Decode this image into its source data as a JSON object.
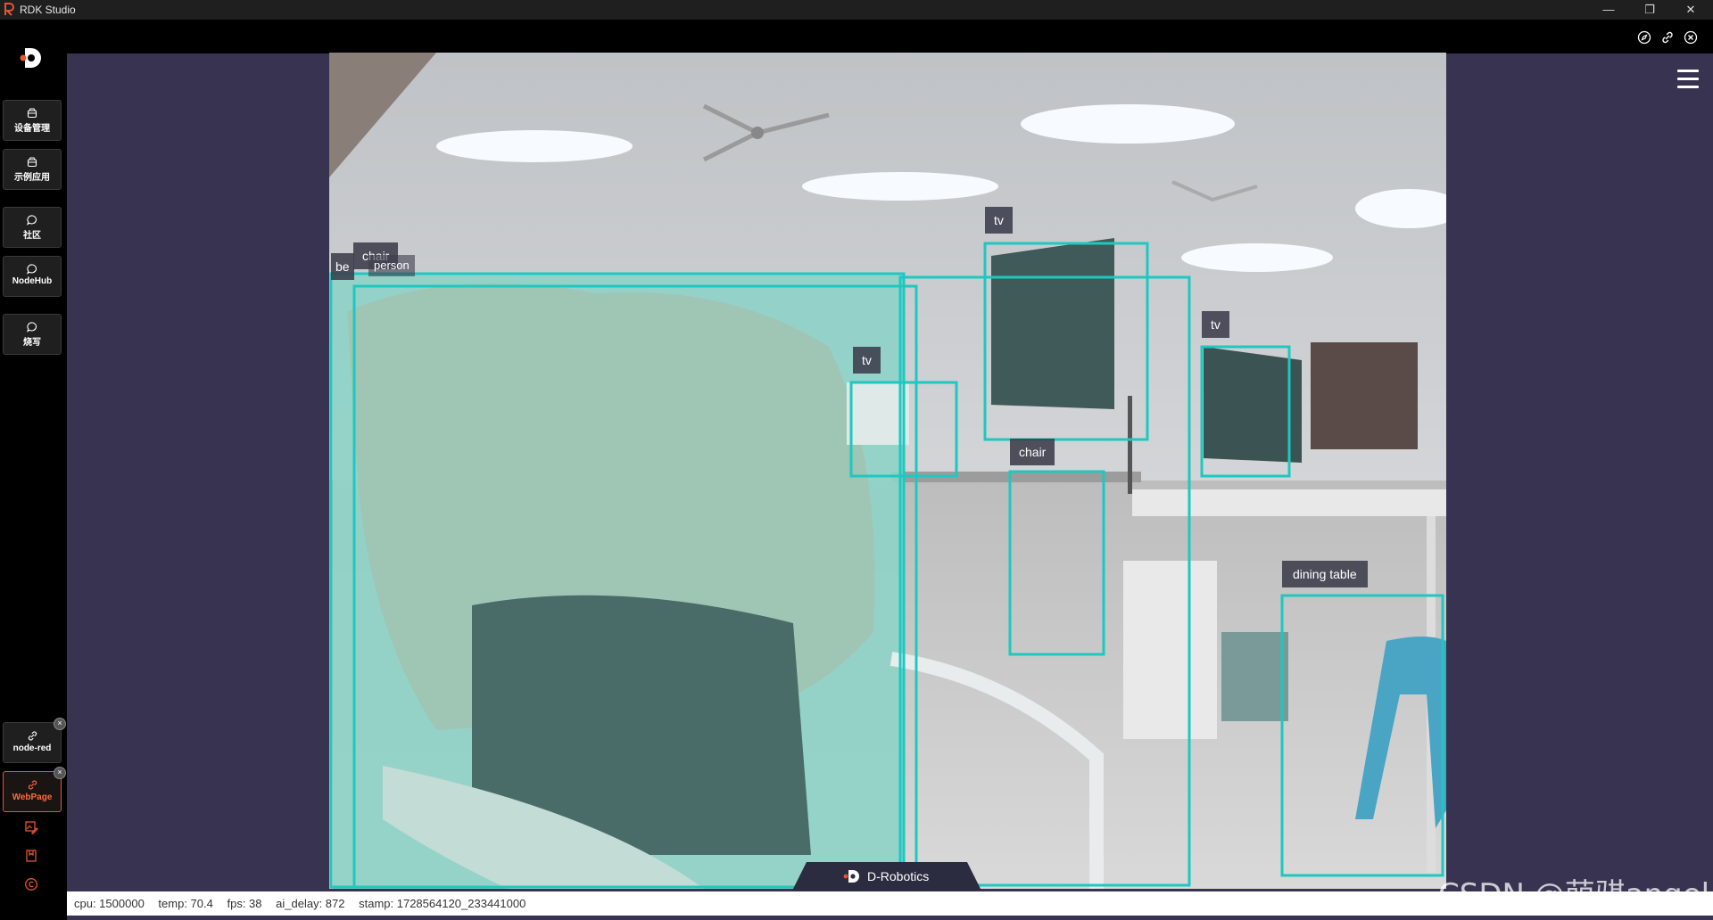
{
  "window": {
    "title": "RDK Studio",
    "controls": [
      "minimize-icon",
      "restore-icon",
      "close-icon"
    ]
  },
  "topbar_icons": [
    "compass-icon",
    "link-icon",
    "close-circle-icon"
  ],
  "sidebar": {
    "items": [
      {
        "label": "设备管理",
        "icon": "package-icon"
      },
      {
        "label": "示例应用",
        "icon": "package-icon"
      },
      {
        "label": "社区",
        "icon": "chat-icon"
      },
      {
        "label": "NodeHub",
        "icon": "chat-icon"
      },
      {
        "label": "烧写",
        "icon": "chat-icon"
      }
    ],
    "pinned": [
      {
        "label": "node-red",
        "icon": "link-icon",
        "active": false
      },
      {
        "label": "WebPage",
        "icon": "link-icon",
        "active": true
      }
    ],
    "bottom_icons": [
      "image-edit-icon",
      "bookmark-icon",
      "copyright-icon"
    ],
    "accent_color": "#ff6a3d"
  },
  "detections": [
    {
      "label": "chair"
    },
    {
      "label": "be"
    },
    {
      "label": "person"
    },
    {
      "label": "tv"
    },
    {
      "label": "tv"
    },
    {
      "label": "tv"
    },
    {
      "label": "chair"
    },
    {
      "label": "dining table"
    }
  ],
  "detection_color": "#1ec8c0",
  "brand": {
    "name": "D-Robotics"
  },
  "status": {
    "cpu": "cpu: 1500000",
    "temp": "temp: 70.4",
    "fps": "fps: 38",
    "ai_delay": "ai_delay: 872",
    "stamp": "stamp: 1728564120_233441000"
  },
  "watermark": "CSDN @萌骐angel"
}
